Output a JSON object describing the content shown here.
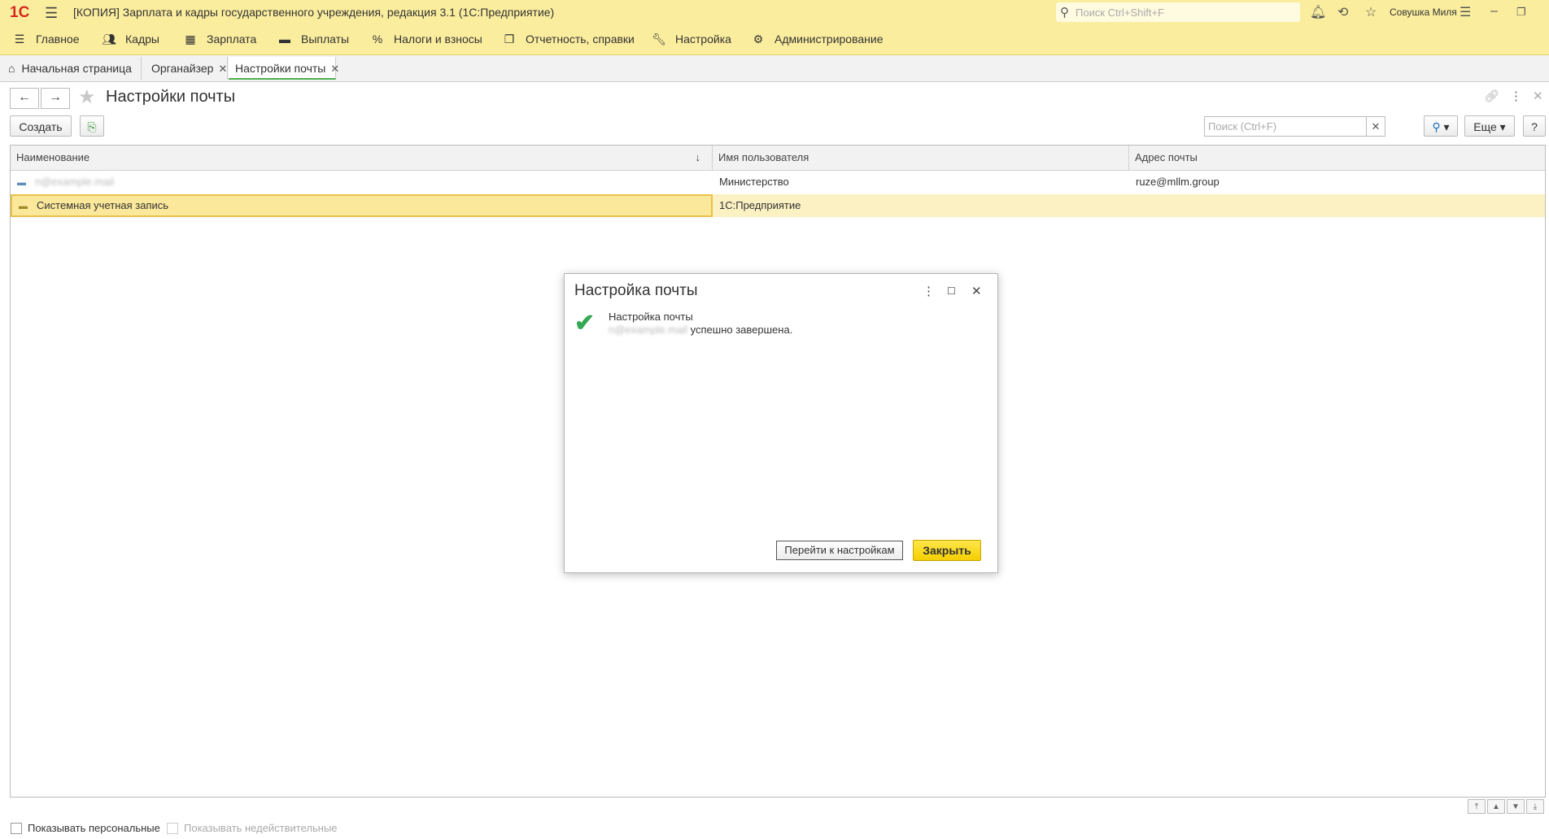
{
  "app": {
    "logo": "1С",
    "title": "[КОПИЯ] Зарплата и кадры государственного учреждения, редакция 3.1  (1С:Предприятие)",
    "search_placeholder": "Поиск Ctrl+Shift+F",
    "user": "Совушка Миля"
  },
  "menu": {
    "items": [
      {
        "label": "Главное",
        "icon": "list-icon"
      },
      {
        "label": "Кадры",
        "icon": "people-icon"
      },
      {
        "label": "Зарплата",
        "icon": "calculator-icon"
      },
      {
        "label": "Выплаты",
        "icon": "wallet-icon"
      },
      {
        "label": "Налоги и взносы",
        "icon": "percent-icon"
      },
      {
        "label": "Отчетность, справки",
        "icon": "documents-icon"
      },
      {
        "label": "Настройка",
        "icon": "wrench-icon"
      },
      {
        "label": "Администрирование",
        "icon": "gear-icon"
      }
    ]
  },
  "tabs": [
    {
      "label": "Начальная страница",
      "active": false
    },
    {
      "label": "Органайзер",
      "active": false
    },
    {
      "label": "Настройки почты",
      "active": true
    }
  ],
  "form": {
    "title": "Настройки почты",
    "create_label": "Создать",
    "search_placeholder": "Поиск (Ctrl+F)",
    "more_label": "Еще",
    "help_label": "?"
  },
  "table": {
    "columns": [
      "Наименование",
      "Имя пользователя",
      "Адрес почты"
    ],
    "rows": [
      {
        "name": "n@example.mail",
        "user": "Министерство",
        "email": "ruze@mllm.group",
        "selected": false
      },
      {
        "name": "Системная учетная запись",
        "user": "1С:Предприятие",
        "email": "",
        "selected": true
      }
    ]
  },
  "footer": {
    "show_personal": "Показывать персональные",
    "show_invalid": "Показывать недействительные"
  },
  "dialog": {
    "title": "Настройка почты",
    "message_line1": "Настройка почты",
    "message_hidden": "n@example.mail",
    "message_line2": "успешно завершена.",
    "goto_label": "Перейти к настройкам",
    "close_label": "Закрыть"
  },
  "colors": {
    "header_bg": "#fbed9e",
    "selection_bg": "#fbf1c3",
    "primary_button": "#f5cf00",
    "success_check": "#34a853",
    "active_tab_underline": "#4caf50"
  }
}
